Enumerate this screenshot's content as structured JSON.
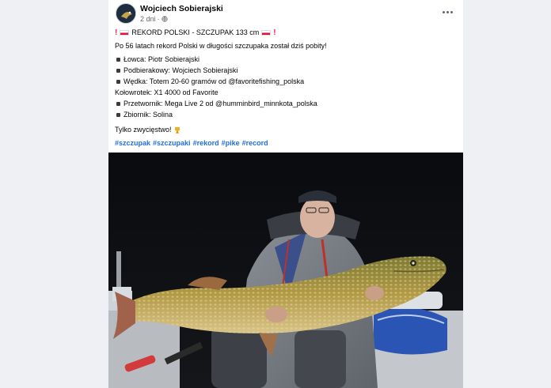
{
  "post": {
    "author": "Wojciech Sobierajski",
    "time": "2 dni",
    "privacy_icon": "globe-icon",
    "more_icon": "more-options-icon",
    "title_prefix": "REKORD POLSKI - SZCZUPAK 133 cm",
    "intro": "Po 56 latach rekord Polski w długości szczupaka został dziś pobity!",
    "details": [
      {
        "bullet": true,
        "text": "Łowca: Piotr Sobierajski"
      },
      {
        "bullet": true,
        "text": "Podbierakowy: Wojciech Sobierajski"
      },
      {
        "bullet": true,
        "text": "Wędka: Totem 20-60 gramów od @favoritefishing_polska"
      },
      {
        "bullet": false,
        "text": "Kołowrotek: X1 4000 od Favorite"
      },
      {
        "bullet": true,
        "text": "Przetwornik: Mega Live 2 od @humminbird_minnkota_polska"
      },
      {
        "bullet": true,
        "text": "Zbiornik: Solina"
      }
    ],
    "closing": "Tylko zwycięstwo!",
    "hashtags": [
      "#szczupak",
      "#szczupaki",
      "#rekord",
      "#pike",
      "#record"
    ],
    "photo_description_icon": "pike-catch-photo"
  },
  "colors": {
    "hashtag": "#216fdb",
    "text": "#050505",
    "meta": "#65676b",
    "flag_red": "#dc143c"
  }
}
